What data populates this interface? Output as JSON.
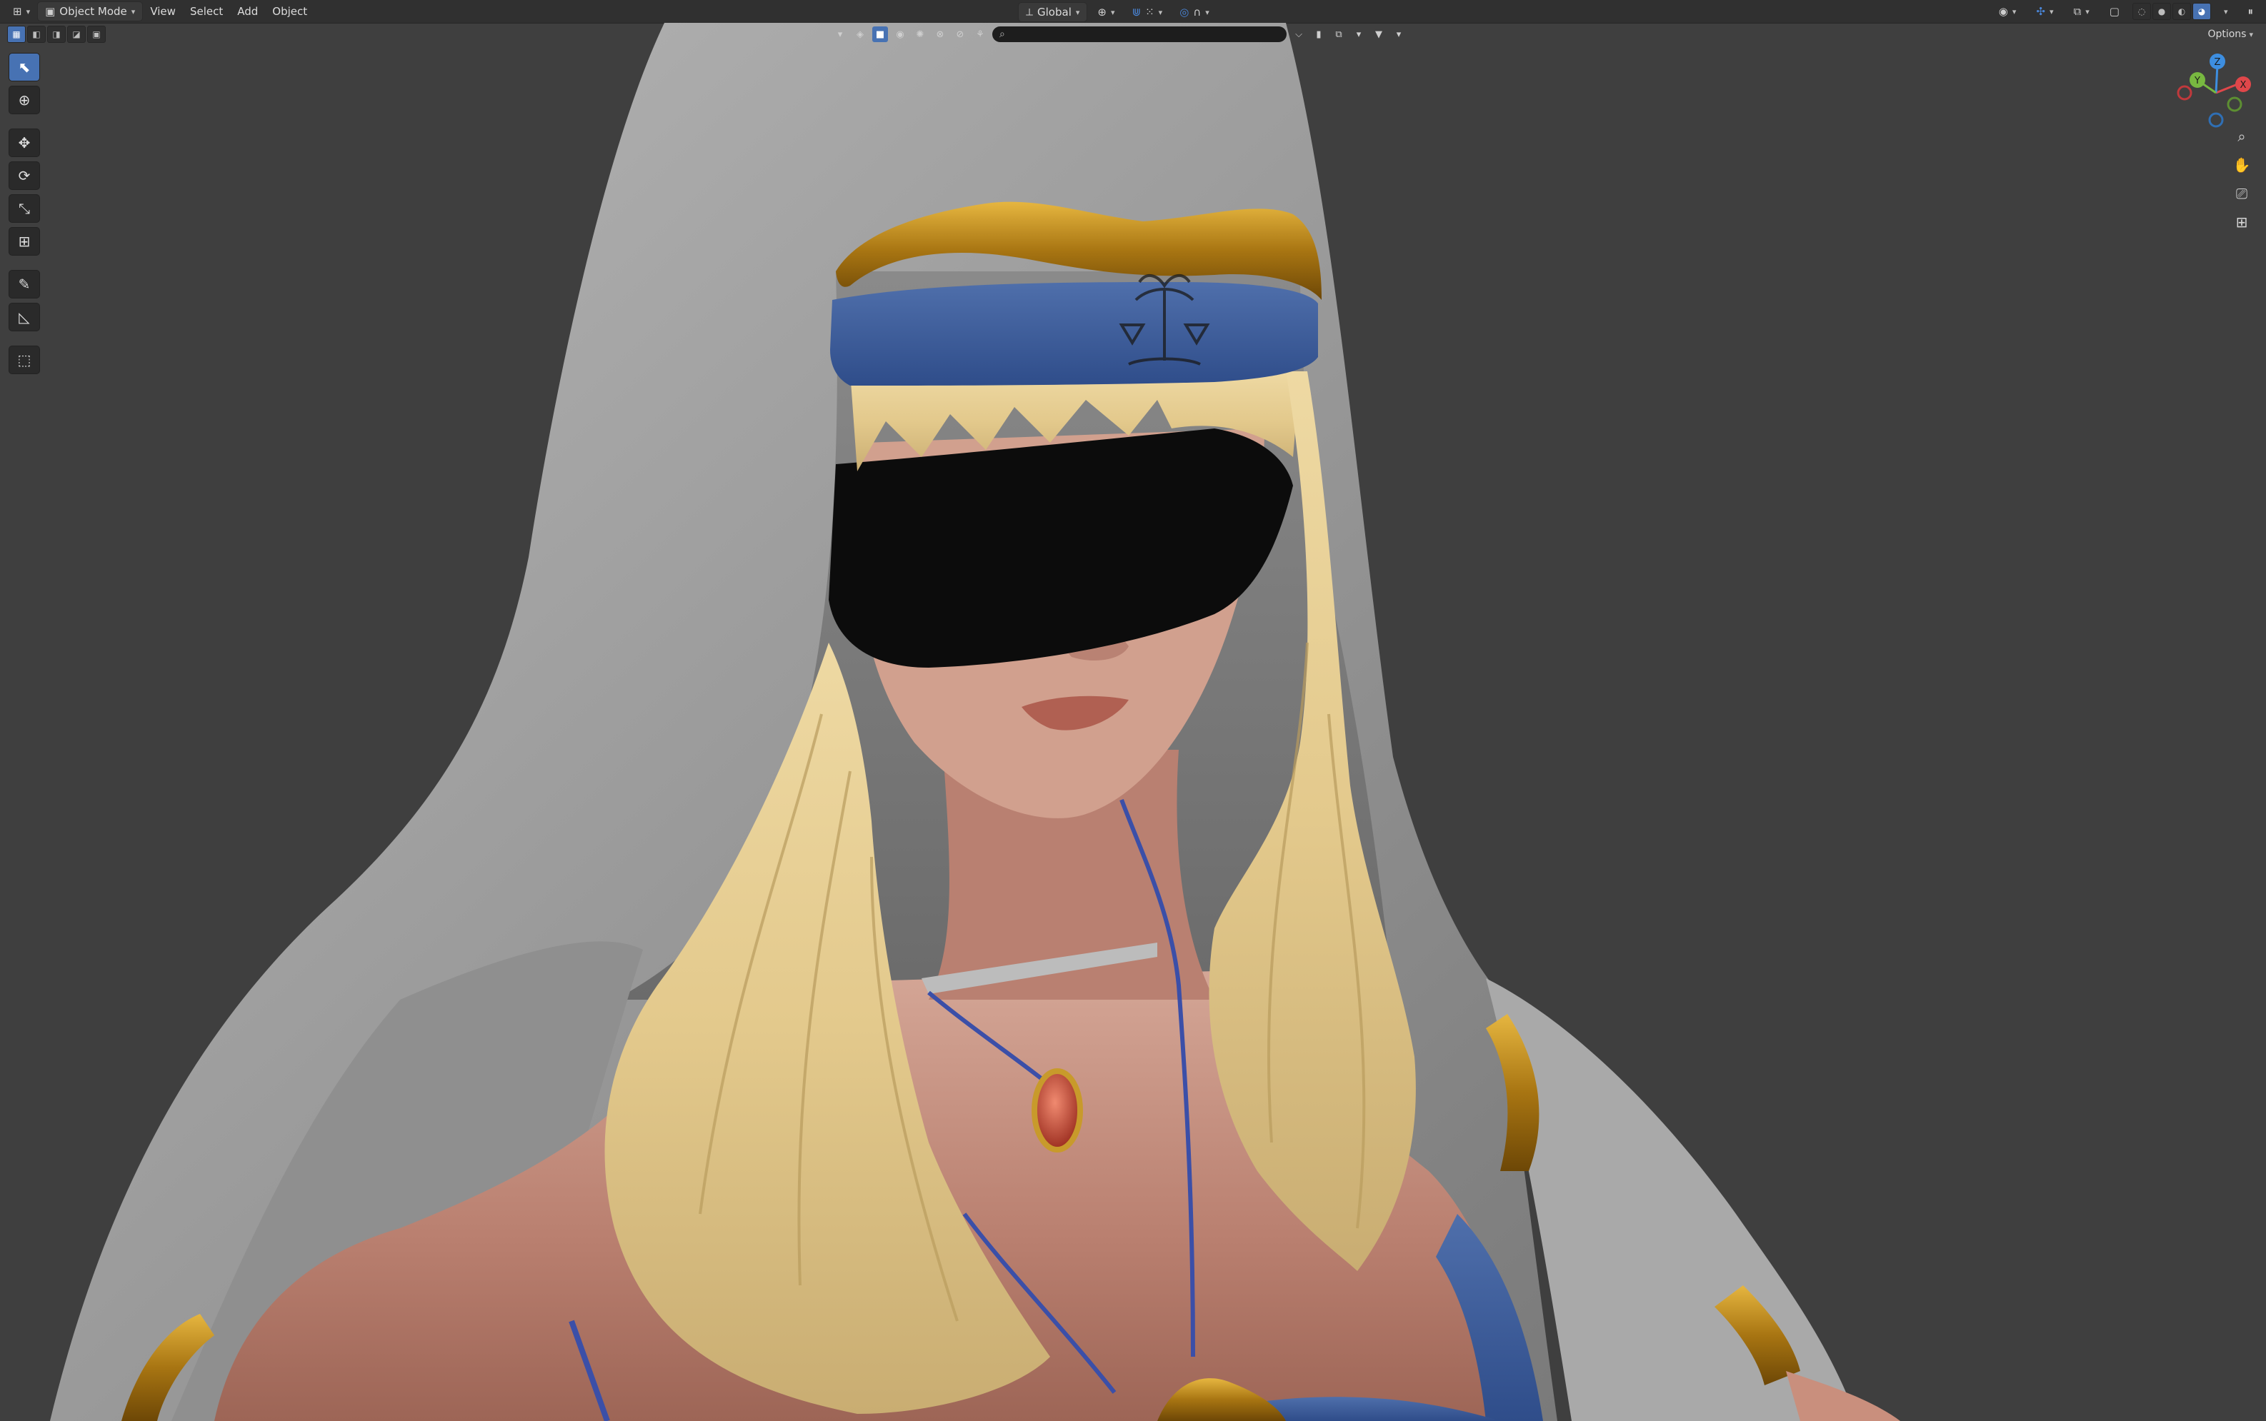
{
  "header": {
    "editor_type_icon": "editor-type-icon",
    "mode_label": "Object Mode",
    "menus": [
      "View",
      "Select",
      "Add",
      "Object"
    ],
    "transform_orientation": "Global"
  },
  "overlay_search": {
    "placeholder": ""
  },
  "options_label": "Options",
  "toolbar": {
    "tools": [
      {
        "name": "select-box-tool",
        "icon": "cursor-arrow",
        "active": true
      },
      {
        "name": "cursor-tool",
        "icon": "target-cursor",
        "active": false
      },
      {
        "name": "move-tool",
        "icon": "move-arrows",
        "active": false
      },
      {
        "name": "rotate-tool",
        "icon": "rotate",
        "active": false
      },
      {
        "name": "scale-tool",
        "icon": "scale",
        "active": false
      },
      {
        "name": "transform-tool",
        "icon": "transform",
        "active": false
      },
      {
        "name": "annotate-tool",
        "icon": "pencil",
        "active": false
      },
      {
        "name": "measure-tool",
        "icon": "ruler",
        "active": false
      },
      {
        "name": "add-cube-tool",
        "icon": "cube-add",
        "active": false
      }
    ]
  },
  "gizmo": {
    "x_label": "X",
    "y_label": "Y",
    "z_label": "Z"
  },
  "colors": {
    "background": "#3f3f3f",
    "header": "#303030",
    "accent": "#4772b3",
    "axis_x": "#e0474a",
    "axis_y": "#78b840",
    "axis_z": "#3d8ee0"
  }
}
